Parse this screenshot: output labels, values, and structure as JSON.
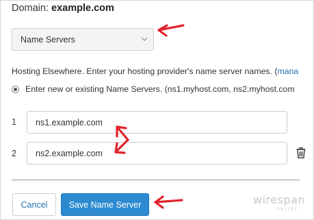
{
  "domain": {
    "label": "Domain:",
    "value": "example.com"
  },
  "nameserver_select": {
    "selected": "Name Servers"
  },
  "hosting_text": "Hosting Elsewhere. Enter your hosting provider's name server names. (",
  "hosting_link": "mana",
  "radio_option_label": "Enter new or existing Name Servers. (ns1.myhost.com, ns2.myhost.com",
  "nameservers": [
    {
      "index": "1",
      "value": "ns1.example.com"
    },
    {
      "index": "2",
      "value": "ns2.example.com"
    }
  ],
  "buttons": {
    "cancel": "Cancel",
    "save": "Save Name Server"
  },
  "watermark": {
    "text": "wirespan",
    "subtext": "ONLINE"
  },
  "colors": {
    "annotation_arrow": "#e0242b",
    "primary_button": "#2d8ad0",
    "link": "#1f6fb2"
  },
  "icons": [
    "chevron-down-icon",
    "radio-selected-icon",
    "trash-icon",
    "arrow-annotation-icon"
  ]
}
